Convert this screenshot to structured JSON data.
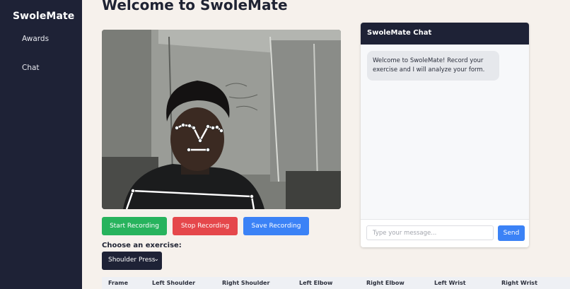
{
  "sidebar": {
    "brand": "SwoleMate",
    "items": [
      {
        "label": "Awards"
      },
      {
        "label": "Chat"
      }
    ]
  },
  "main": {
    "title": "Welcome to SwoleMate",
    "buttons": {
      "start": "Start Recording",
      "stop": "Stop Recording",
      "save": "Save Recording"
    },
    "exercise_label": "Choose an exercise:",
    "exercise_selected": "Shoulder Press",
    "table_headers": [
      "Frame",
      "Left Shoulder",
      "Right Shoulder",
      "Left Elbow",
      "Right Elbow",
      "Left Wrist",
      "Right Wrist"
    ]
  },
  "chat": {
    "title": "SwoleMate Chat",
    "messages": [
      {
        "from": "bot",
        "text": "Welcome to SwoleMate! Record your exercise and I will analyze your form."
      }
    ],
    "input_placeholder": "Type your message...",
    "send_label": "Send"
  },
  "colors": {
    "sidebar": "#1e2236",
    "background": "#f6f1ec",
    "start": "#27b35d",
    "stop": "#e5474b",
    "save": "#3b82f6",
    "send": "#3b82f6"
  },
  "icons": {
    "select_chevron": "chevron-down-icon"
  }
}
